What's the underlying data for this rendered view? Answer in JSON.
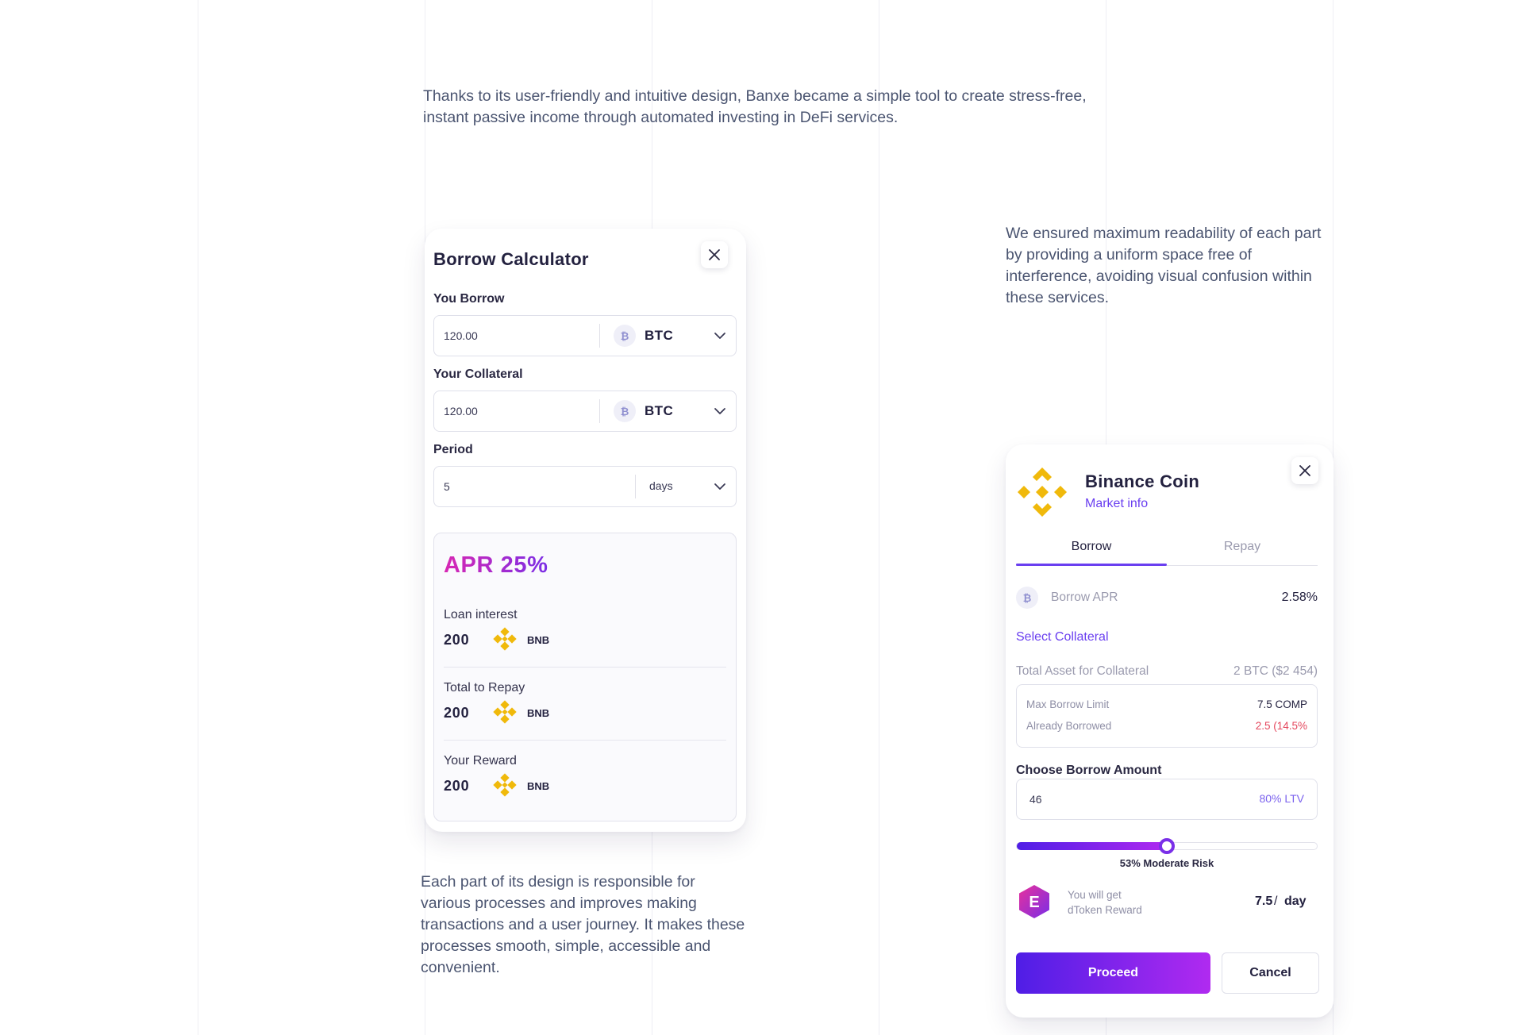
{
  "intro_text": "Thanks to its user-friendly and intuitive design, Banxe became a simple tool to create stress-free, instant passive income through automated investing in DeFi services.",
  "readability_text": "We ensured maximum readability of each part by providing a uniform space free of interference, avoiding visual confusion within these services.",
  "design_text": "Each part of its design is responsible for various processes and improves making transactions and a user journey. It makes these processes smooth, simple, accessible and convenient.",
  "borrow_calculator": {
    "title": "Borrow Calculator",
    "you_borrow": {
      "label": "You Borrow",
      "value": "120.00",
      "coin_icon": "₿",
      "currency": "BTC"
    },
    "your_collateral": {
      "label": "Your Collateral",
      "value": "120.00",
      "coin_icon": "₿",
      "currency": "BTC"
    },
    "period": {
      "label": "Period",
      "value": "5",
      "unit": "days"
    },
    "apr": "APR 25%",
    "rows": [
      {
        "label": "Loan interest",
        "amount": "200",
        "token": "BNB"
      },
      {
        "label": "Total to Repay",
        "amount": "200",
        "token": "BNB"
      },
      {
        "label": "Your Reward",
        "amount": "200",
        "token": "BNB"
      }
    ]
  },
  "binance_card": {
    "title": "Binance Coin",
    "market_info": "Market info",
    "tabs": [
      {
        "label": "Borrow",
        "active": true
      },
      {
        "label": "Repay",
        "active": false
      }
    ],
    "borrow_apr_icon": "₿",
    "borrow_apr_label": "Borrow APR",
    "borrow_apr_value": "2.58%",
    "select_collateral": "Select Collateral",
    "total_asset_label": "Total Asset for Collateral",
    "total_asset_value": "2 BTC ($2 454)",
    "max_borrow_label": "Max Borrow Limit",
    "max_borrow_value": "7.5 COMP",
    "already_borrowed_label": "Already Borrowed",
    "already_borrowed_value": "2.5 (14.5%",
    "choose_amount_label": "Choose Borrow Amount",
    "amount_value": "46",
    "ltv": "80% LTV",
    "risk_fraction": 0.5,
    "risk_label": "53% Moderate Risk",
    "reward_badge": "E",
    "reward_line1": "You will get",
    "reward_line2": "dToken Reward",
    "reward_value": "7.5",
    "reward_slash": "/",
    "reward_unit": "day",
    "proceed": "Proceed",
    "cancel": "Cancel"
  },
  "colors": {
    "accent": "#6a3ff0",
    "gradient_start": "#4f1ee6",
    "gradient_end": "#b02af0",
    "bnb_yellow": "#f0b90b",
    "danger": "#e4475d"
  }
}
